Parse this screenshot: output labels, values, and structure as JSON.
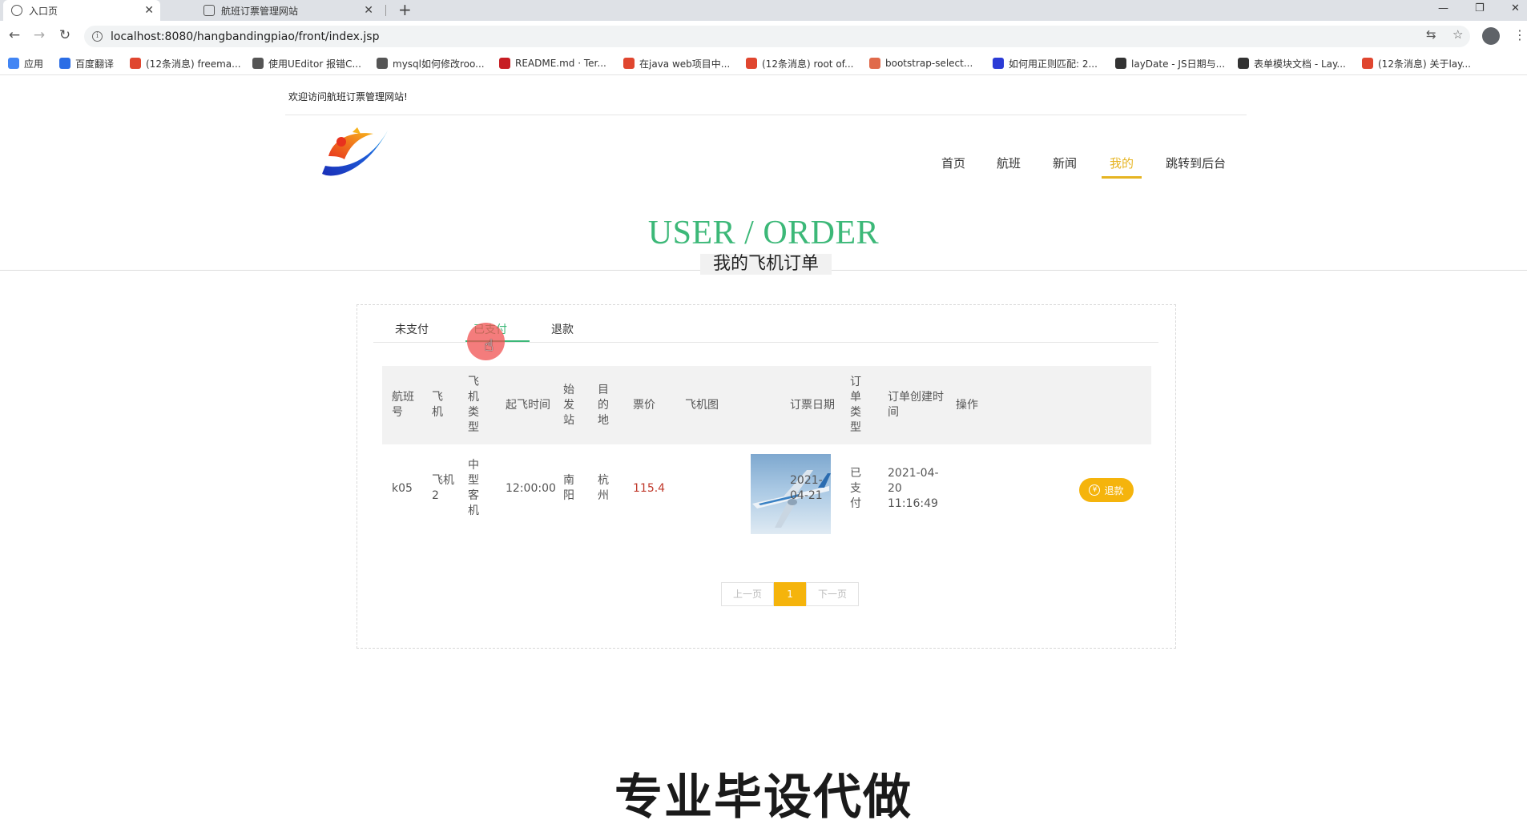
{
  "browser": {
    "tabs": [
      {
        "title": "入口页",
        "active": true
      },
      {
        "title": "航班订票管理网站",
        "active": false
      }
    ],
    "new_tab": "+",
    "window_controls": {
      "minimize": "—",
      "restore": "❐",
      "close": "✕"
    },
    "url": "localhost:8080/hangbandingpiao/front/index.jsp",
    "bookmarks": [
      {
        "label": "应用",
        "icon": "apps-grid-icon",
        "color": "#4285f4"
      },
      {
        "label": "百度翻译",
        "icon": "baidu-translate-icon",
        "color": "#2b6de5"
      },
      {
        "label": "(12条消息) freema...",
        "icon": "csdn-icon",
        "color": "#e0462f"
      },
      {
        "label": "使用UEditor 报错C...",
        "icon": "bird-icon",
        "color": "#555555"
      },
      {
        "label": "mysql如何修改roo...",
        "icon": "bird-icon",
        "color": "#555555"
      },
      {
        "label": "README.md · Ter...",
        "icon": "gitee-icon",
        "color": "#c71d23"
      },
      {
        "label": "在java web项目中...",
        "icon": "csdn-icon",
        "color": "#e0462f"
      },
      {
        "label": "(12条消息) root of...",
        "icon": "csdn-icon",
        "color": "#e0462f"
      },
      {
        "label": "bootstrap-select...",
        "icon": "doc-icon",
        "color": "#e06a4a"
      },
      {
        "label": "如何用正则匹配: 2...",
        "icon": "baidu-paw-icon",
        "color": "#2b3bd6"
      },
      {
        "label": "layDate - JS日期与...",
        "icon": "layui-icon",
        "color": "#333333"
      },
      {
        "label": "表单模块文档 - Lay...",
        "icon": "layui-icon",
        "color": "#333333"
      },
      {
        "label": "(12条消息) 关于lay...",
        "icon": "csdn-icon",
        "color": "#e0462f"
      }
    ]
  },
  "site": {
    "welcome": "欢迎访问航班订票管理网站!",
    "nav": [
      "首页",
      "航班",
      "新闻",
      "我的",
      "跳转到后台"
    ],
    "active_nav": "我的",
    "accent": "#e6b422",
    "title": "USER / ORDER",
    "subtitle": "我的飞机订单",
    "title_color": "#3cb878"
  },
  "orders": {
    "tabs": [
      "未支付",
      "已支付",
      "退款"
    ],
    "active_tab": "已支付",
    "columns": [
      "航班号",
      "飞机",
      "飞机类型",
      "起飞时间",
      "始发站",
      "目的地",
      "票价",
      "飞机图",
      "订票日期",
      "订单类型",
      "订单创建时间",
      "操作"
    ],
    "rows": [
      {
        "flight_no": "k05",
        "plane": "飞机2",
        "plane_type": "中型客机",
        "departure_time": "12:00:00",
        "origin": "南阳",
        "destination": "杭州",
        "price": "115.4",
        "image": "airplane-photo",
        "booking_date": "2021-04-21",
        "order_type": "已支付",
        "created_at": "2021-04-20 11:16:49",
        "action": "退款"
      }
    ],
    "pager": {
      "prev": "上一页",
      "current": "1",
      "next": "下一页"
    }
  },
  "watermark": "专业毕设代做"
}
